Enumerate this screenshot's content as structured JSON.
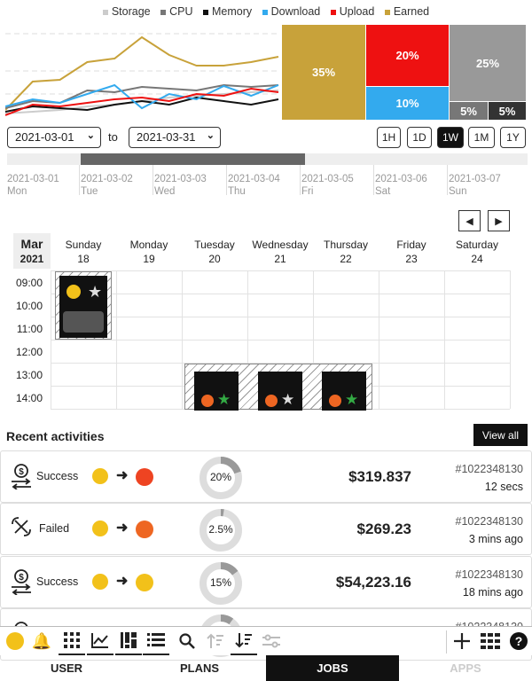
{
  "legend": [
    {
      "label": "Storage",
      "color": "#cccccc"
    },
    {
      "label": "CPU",
      "color": "#777777"
    },
    {
      "label": "Memory",
      "color": "#111111"
    },
    {
      "label": "Download",
      "color": "#33aaee"
    },
    {
      "label": "Upload",
      "color": "#ee1111"
    },
    {
      "label": "Earned",
      "color": "#c8a23a"
    }
  ],
  "chart_data": {
    "type": "line",
    "series": [
      {
        "name": "Earned",
        "values": [
          8,
          40,
          42,
          62,
          66,
          90,
          70,
          58,
          58,
          62,
          68
        ]
      },
      {
        "name": "Storage",
        "values": [
          4,
          6,
          8,
          12,
          14,
          18,
          22,
          24,
          26,
          28,
          30
        ]
      },
      {
        "name": "CPU",
        "values": [
          10,
          18,
          16,
          30,
          28,
          34,
          32,
          30,
          36,
          34,
          36
        ]
      },
      {
        "name": "Memory",
        "values": [
          6,
          12,
          10,
          8,
          14,
          18,
          14,
          22,
          18,
          14,
          20
        ]
      },
      {
        "name": "Download",
        "values": [
          12,
          20,
          16,
          26,
          36,
          10,
          26,
          20,
          35,
          24,
          36
        ]
      },
      {
        "name": "Upload",
        "values": [
          2,
          14,
          12,
          16,
          20,
          22,
          18,
          26,
          24,
          32,
          28
        ]
      }
    ]
  },
  "treemap": [
    {
      "label": "35%",
      "color": "#c8a23a"
    },
    {
      "label": "20%",
      "color": "#ee1111"
    },
    {
      "label": "10%",
      "color": "#33aaee"
    },
    {
      "label": "25%",
      "color": "#999999"
    },
    {
      "label": "5%",
      "color": "#777777"
    },
    {
      "label": "5%",
      "color": "#333333"
    }
  ],
  "range": {
    "start": "2021-03-01",
    "to": "to",
    "end": "2021-03-31",
    "buttons": [
      "1H",
      "1D",
      "1W",
      "1M",
      "1Y"
    ],
    "active": "1W"
  },
  "timeline": [
    {
      "date": "2021-03-01",
      "day": "Mon"
    },
    {
      "date": "2021-03-02",
      "day": "Tue"
    },
    {
      "date": "2021-03-03",
      "day": "Wed"
    },
    {
      "date": "2021-03-04",
      "day": "Thu"
    },
    {
      "date": "2021-03-05",
      "day": "Fri"
    },
    {
      "date": "2021-03-06",
      "day": "Sat"
    },
    {
      "date": "2021-03-07",
      "day": "Sun"
    }
  ],
  "calendar": {
    "month": "Mar",
    "year": "2021",
    "days": [
      {
        "name": "Sunday",
        "num": "18"
      },
      {
        "name": "Monday",
        "num": "19"
      },
      {
        "name": "Tuesday",
        "num": "20"
      },
      {
        "name": "Wednesday",
        "num": "21"
      },
      {
        "name": "Thursday",
        "num": "22"
      },
      {
        "name": "Friday",
        "num": "23"
      },
      {
        "name": "Saturday",
        "num": "24"
      }
    ],
    "times": [
      "09:00",
      "10:00",
      "11:00",
      "12:00",
      "13:00",
      "14:00"
    ]
  },
  "activities": {
    "title": "Recent activities",
    "view_all": "View all",
    "rows": [
      {
        "status": "Success",
        "percent": "20%",
        "fraction": 0.2,
        "amount": "$319.837",
        "id": "#1022348130",
        "ago": "12 secs"
      },
      {
        "status": "Failed",
        "percent": "2.5%",
        "fraction": 0.025,
        "amount": "$269.23",
        "id": "#1022348130",
        "ago": "3 mins ago"
      },
      {
        "status": "Success",
        "percent": "15%",
        "fraction": 0.15,
        "amount": "$54,223.16",
        "id": "#1022348130",
        "ago": "18 mins ago"
      },
      {
        "status": "",
        "percent": "",
        "fraction": 0.1,
        "amount": "",
        "id": "#1022348130",
        "ago": ""
      }
    ]
  },
  "tabs": [
    {
      "label": "USER",
      "state": "normal"
    },
    {
      "label": "PLANS",
      "state": "normal"
    },
    {
      "label": "JOBS",
      "state": "active"
    },
    {
      "label": "APPS",
      "state": "disabled"
    }
  ]
}
